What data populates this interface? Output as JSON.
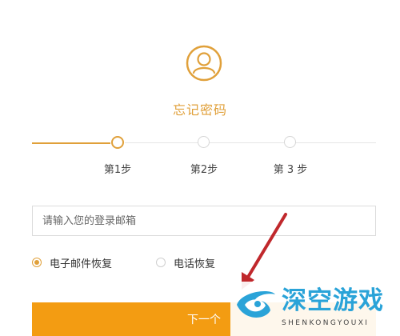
{
  "page": {
    "title": "忘记密码",
    "icon": "user-avatar-icon",
    "accent_color": "#e0a03a",
    "button_color": "#f39c12"
  },
  "steps": [
    {
      "label": "第1步",
      "state": "active"
    },
    {
      "label": "第2步",
      "state": "pending"
    },
    {
      "label": "第 3 步",
      "state": "pending"
    }
  ],
  "form": {
    "email_placeholder": "请输入您的登录邮箱",
    "email_value": "",
    "recovery_options": [
      {
        "label": "电子邮件恢复",
        "checked": true
      },
      {
        "label": "电话恢复",
        "checked": false
      }
    ],
    "next_label": "下一个"
  },
  "watermark": {
    "text": "深空游戏",
    "subtext": "SHENKONGYOUXI",
    "color": "#2aa3d8"
  },
  "annotation": {
    "arrow_color": "#c0282c"
  }
}
